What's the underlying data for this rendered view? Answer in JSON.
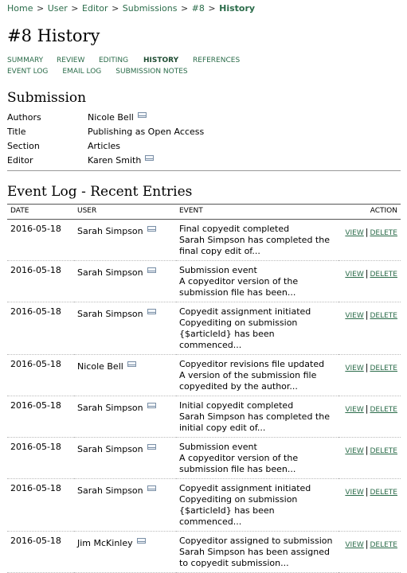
{
  "breadcrumb": {
    "items": [
      "Home",
      "User",
      "Editor",
      "Submissions",
      "#8"
    ],
    "current": "History",
    "separator": ">"
  },
  "page_title": "#8 History",
  "menu": {
    "row1": [
      "SUMMARY",
      "REVIEW",
      "EDITING",
      "HISTORY",
      "REFERENCES"
    ],
    "row2": [
      "EVENT LOG",
      "EMAIL LOG",
      "SUBMISSION NOTES"
    ],
    "active": "HISTORY"
  },
  "submission": {
    "heading": "Submission",
    "rows": [
      {
        "label": "Authors",
        "value": "Nicole Bell",
        "email_icon": true
      },
      {
        "label": "Title",
        "value": "Publishing as Open Access",
        "email_icon": false
      },
      {
        "label": "Section",
        "value": "Articles",
        "email_icon": false
      },
      {
        "label": "Editor",
        "value": "Karen Smith",
        "email_icon": true
      }
    ]
  },
  "event_log": {
    "heading": "Event Log - Recent Entries",
    "columns": {
      "date": "DATE",
      "user": "USER",
      "event": "EVENT",
      "action": "ACTION"
    },
    "view_label": "VIEW",
    "delete_label": "DELETE",
    "action_separator": "|",
    "entries": [
      {
        "date": "2016-05-18",
        "user": "Sarah Simpson",
        "event_title": "Final copyedit completed",
        "event_desc1": "Sarah Simpson has completed the",
        "event_desc2": "final copy edit of..."
      },
      {
        "date": "2016-05-18",
        "user": "Sarah Simpson",
        "event_title": "Submission event",
        "event_desc1": "A copyeditor version of the",
        "event_desc2": "submission file has been..."
      },
      {
        "date": "2016-05-18",
        "user": "Sarah Simpson",
        "event_title": "Copyedit assignment initiated",
        "event_desc1": "Copyediting on submission",
        "event_desc2": "{$articleId} has been commenced..."
      },
      {
        "date": "2016-05-18",
        "user": "Nicole Bell",
        "event_title": "Copyeditor revisions file updated",
        "event_desc1": "A version of the submission file",
        "event_desc2": "copyedited by the author..."
      },
      {
        "date": "2016-05-18",
        "user": "Sarah Simpson",
        "event_title": "Initial copyedit completed",
        "event_desc1": "Sarah Simpson has completed the",
        "event_desc2": "initial copy edit of..."
      },
      {
        "date": "2016-05-18",
        "user": "Sarah Simpson",
        "event_title": "Submission event",
        "event_desc1": "A copyeditor version of the",
        "event_desc2": "submission file has been..."
      },
      {
        "date": "2016-05-18",
        "user": "Sarah Simpson",
        "event_title": "Copyedit assignment initiated",
        "event_desc1": "Copyediting on submission",
        "event_desc2": "{$articleId} has been commenced..."
      },
      {
        "date": "2016-05-18",
        "user": "Jim McKinley",
        "event_title": "Copyeditor assigned to submission",
        "event_desc1": "Sarah Simpson has been assigned",
        "event_desc2": "to copyedit submission..."
      }
    ]
  },
  "colors": {
    "link": "#2b6c4a",
    "text": "#000000"
  }
}
